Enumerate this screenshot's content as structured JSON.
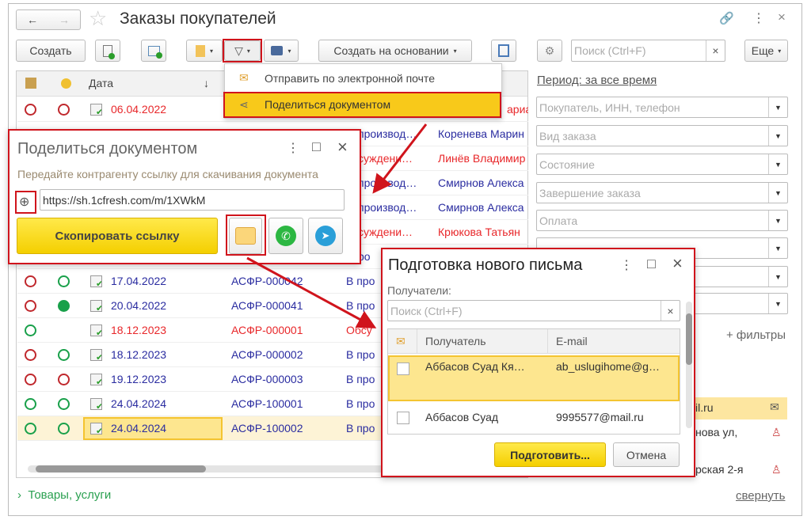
{
  "window": {
    "title": "Заказы покупателей",
    "back": "←",
    "forward": "→",
    "star": "☆",
    "link": "🔗",
    "more": "⋮",
    "close": "×"
  },
  "toolbar": {
    "create": "Создать",
    "create_based": "Создать на основании",
    "search_placeholder": "Поиск (Ctrl+F)",
    "search_clear": "×",
    "more": "Еще"
  },
  "menu": {
    "items": [
      {
        "label": "Отправить по электронной почте"
      },
      {
        "label": "Поделиться документом"
      }
    ]
  },
  "table": {
    "headers": {
      "date": "Дата",
      "sort": "↓"
    },
    "rows": [
      {
        "date": "06.04.2022",
        "number": "",
        "status": "",
        "customer": "ариа",
        "color": "red",
        "c1": "red",
        "c2": "red"
      },
      {
        "date": "",
        "number": "",
        "status": "производ…",
        "customer": "Коренева Марин",
        "color": "blue",
        "scolor": "blue",
        "c1": "",
        "c2": ""
      },
      {
        "date": "",
        "number": "",
        "status": "суждени…",
        "customer": "Линёв Владимир",
        "color": "red",
        "scolor": "red",
        "c1": "",
        "c2": ""
      },
      {
        "date": "",
        "number": "",
        "status": "производ…",
        "customer": "Смирнов Алекса",
        "color": "blue",
        "scolor": "blue",
        "c1": "",
        "c2": ""
      },
      {
        "date": "",
        "number": "",
        "status": "производ…",
        "customer": "Смирнов Алекса",
        "color": "blue",
        "scolor": "blue",
        "c1": "",
        "c2": ""
      },
      {
        "date": "",
        "number": "",
        "status": "суждени…",
        "customer": "Крюкова Татьян",
        "color": "red",
        "scolor": "red",
        "c1": "",
        "c2": ""
      },
      {
        "date": "",
        "number": "",
        "status": "ро",
        "customer": "",
        "color": "blue",
        "scolor": "blue",
        "c1": "",
        "c2": ""
      },
      {
        "date": "17.04.2022",
        "number": "АСФР-000042",
        "status": "В про",
        "customer": "",
        "color": "blue",
        "c1": "red",
        "c2": "green"
      },
      {
        "date": "20.04.2022",
        "number": "АСФР-000041",
        "status": "В про",
        "customer": "",
        "color": "blue",
        "c1": "red",
        "c2": "greenfill"
      },
      {
        "date": "18.12.2023",
        "number": "АСФР-000001",
        "status": "Обсу",
        "customer": "",
        "color": "red",
        "c1": "green",
        "c2": ""
      },
      {
        "date": "18.12.2023",
        "number": "АСФР-000002",
        "status": "В про",
        "customer": "",
        "color": "blue",
        "c1": "red",
        "c2": "green"
      },
      {
        "date": "19.12.2023",
        "number": "АСФР-000003",
        "status": "В про",
        "customer": "",
        "color": "blue",
        "c1": "red",
        "c2": "red"
      },
      {
        "date": "24.04.2024",
        "number": "АСФР-100001",
        "status": "В про",
        "customer": "",
        "color": "blue",
        "c1": "green",
        "c2": "green"
      },
      {
        "date": "24.04.2024",
        "number": "АСФР-100002",
        "status": "В про",
        "customer": "",
        "color": "blue",
        "c1": "green",
        "c2": "green",
        "selected": true
      }
    ]
  },
  "filters": {
    "period": "Период: за все время",
    "fields": [
      "Покупатель, ИНН, телефон",
      "Вид заказа",
      "Состояние",
      "Завершение заказа",
      "Оплата",
      "",
      "",
      ""
    ],
    "more_filters": "+ фильтры",
    "contacts": [
      "il.ru",
      "нова ул,",
      "рская 2-я"
    ],
    "collapse": "свернуть"
  },
  "footer": {
    "goods": "Товары, услуги"
  },
  "share": {
    "title": "Поделиться документом",
    "hint": "Передайте контрагенту ссылку для скачивания документа",
    "url": "https://sh.1cfresh.com/m/1XWkM",
    "copy": "Скопировать ссылку",
    "more": "⋮",
    "maximize": "□",
    "close": "×"
  },
  "letter": {
    "title": "Подготовка нового письма",
    "recipients_label": "Получатели:",
    "search_placeholder": "Поиск (Ctrl+F)",
    "clear": "×",
    "col_recipient": "Получатель",
    "col_email": "E-mail",
    "rows": [
      {
        "name": "Аббасов Суад Кя…",
        "email": "ab_uslugihome@g…"
      },
      {
        "name": "Аббасов Суад",
        "email": "9995577@mail.ru"
      }
    ],
    "prepare": "Подготовить...",
    "cancel": "Отмена",
    "more": "⋮",
    "maximize": "□",
    "close": "×"
  },
  "colors": {
    "accent": "#f8d41a",
    "highlight": "#fde6a0",
    "red": "#d0141c",
    "green": "#19a04a"
  }
}
